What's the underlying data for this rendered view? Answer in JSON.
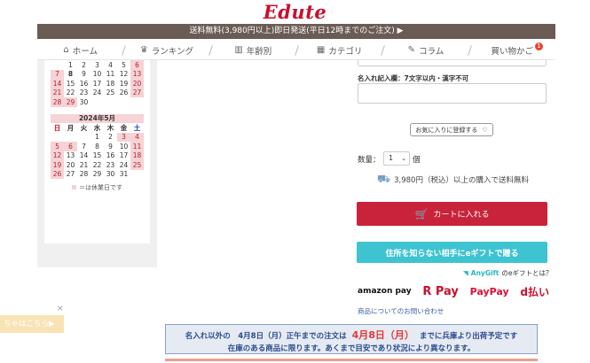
{
  "logo": "Edute",
  "banner": "送料無料(3,980円以上)即日発送(平日12時までのご注文)  ▶",
  "nav": [
    {
      "label": "ホーム",
      "icon": "⌂"
    },
    {
      "label": "ランキング",
      "icon": "♛"
    },
    {
      "label": "年齢別",
      "icon": "▥"
    },
    {
      "label": "カテゴリ",
      "icon": "▦"
    },
    {
      "label": "コラム",
      "icon": "✎"
    },
    {
      "label": "買い物かご",
      "icon": "",
      "badge": "1"
    }
  ],
  "calendar_april": {
    "rows": [
      [
        "",
        "1",
        "2",
        "3",
        "4",
        "5",
        "6"
      ],
      [
        "7",
        "8",
        "9",
        "10",
        "11",
        "12",
        "13"
      ],
      [
        "14",
        "15",
        "16",
        "17",
        "18",
        "19",
        "20"
      ],
      [
        "21",
        "22",
        "23",
        "24",
        "25",
        "26",
        "27"
      ],
      [
        "28",
        "29",
        "30",
        "",
        "",
        "",
        ""
      ]
    ]
  },
  "calendar_may": {
    "title": "2024年5月",
    "weekdays": [
      "日",
      "月",
      "火",
      "水",
      "木",
      "金",
      "土"
    ],
    "rows": [
      [
        "",
        "",
        "",
        "1",
        "2",
        "3",
        "4"
      ],
      [
        "5",
        "6",
        "7",
        "8",
        "9",
        "10",
        "11"
      ],
      [
        "12",
        "13",
        "14",
        "15",
        "16",
        "17",
        "18"
      ],
      [
        "19",
        "20",
        "21",
        "22",
        "23",
        "24",
        "25"
      ],
      [
        "26",
        "27",
        "28",
        "29",
        "30",
        "31",
        ""
      ]
    ]
  },
  "calendar_legend": "＝は休業日です",
  "float_tab": "ちゃはこちら▶",
  "float_close": "×",
  "engrave_label": "名入れ記入欄：7文字以内・漢字不可",
  "favorite_button": "お気に入りに登録する",
  "quantity": {
    "label": "数量：",
    "value": "1",
    "unit": "個"
  },
  "free_shipping": "3,980円（税込）以上の購入で送料無料",
  "cart_button": "カートに入れる",
  "gift_button": "住所を知らない相手にeギフトで贈る",
  "anygift": {
    "brand": "AnyGift",
    "text": "のeギフトとは？"
  },
  "payments": [
    "amazon pay",
    "R Pay",
    "PayPay",
    "d払い"
  ],
  "inquiry_link": "商品についてのお問い合わせ",
  "ship_notice": {
    "line1_prefix": "名入れ以外の　4月8日（月）正午までの注文は",
    "line1_date": "4月8日（月）",
    "line1_suffix": "までに兵庫より出荷予定です",
    "line2": "在庫のある商品に限ります。あくまで目安であり状況により異なります。"
  }
}
